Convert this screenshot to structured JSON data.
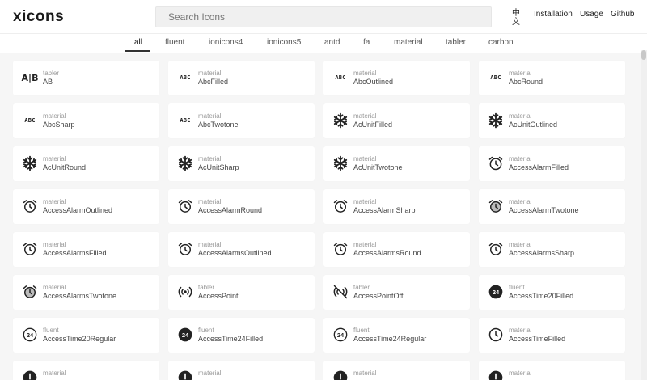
{
  "header": {
    "logo": "xicons",
    "search_placeholder": "Search Icons",
    "lang_label": "中文",
    "nav": [
      "Installation",
      "Usage",
      "Github"
    ]
  },
  "tabs": [
    "all",
    "fluent",
    "ionicons4",
    "ionicons5",
    "antd",
    "fa",
    "material",
    "tabler",
    "carbon"
  ],
  "active_tab": "all",
  "icons": [
    {
      "source": "tabler",
      "name": "AB",
      "icon": "ab-icon"
    },
    {
      "source": "material",
      "name": "AbcFilled",
      "icon": "abc-icon"
    },
    {
      "source": "material",
      "name": "AbcOutlined",
      "icon": "abc-icon"
    },
    {
      "source": "material",
      "name": "AbcRound",
      "icon": "abc-icon"
    },
    {
      "source": "material",
      "name": "AbcSharp",
      "icon": "abc-icon"
    },
    {
      "source": "material",
      "name": "AbcTwotone",
      "icon": "abc-icon"
    },
    {
      "source": "material",
      "name": "AcUnitFilled",
      "icon": "snowflake-icon"
    },
    {
      "source": "material",
      "name": "AcUnitOutlined",
      "icon": "snowflake-icon"
    },
    {
      "source": "material",
      "name": "AcUnitRound",
      "icon": "snowflake-icon"
    },
    {
      "source": "material",
      "name": "AcUnitSharp",
      "icon": "snowflake-icon"
    },
    {
      "source": "material",
      "name": "AcUnitTwotone",
      "icon": "snowflake-icon"
    },
    {
      "source": "material",
      "name": "AccessAlarmFilled",
      "icon": "alarm-icon"
    },
    {
      "source": "material",
      "name": "AccessAlarmOutlined",
      "icon": "alarm-clock-icon"
    },
    {
      "source": "material",
      "name": "AccessAlarmRound",
      "icon": "alarm-clock-icon"
    },
    {
      "source": "material",
      "name": "AccessAlarmSharp",
      "icon": "alarm-clock-icon"
    },
    {
      "source": "material",
      "name": "AccessAlarmTwotone",
      "icon": "alarm-clock-twotone-icon"
    },
    {
      "source": "material",
      "name": "AccessAlarmsFilled",
      "icon": "alarm-clock-icon"
    },
    {
      "source": "material",
      "name": "AccessAlarmsOutlined",
      "icon": "alarm-clock-icon"
    },
    {
      "source": "material",
      "name": "AccessAlarmsRound",
      "icon": "alarm-clock-icon"
    },
    {
      "source": "material",
      "name": "AccessAlarmsSharp",
      "icon": "alarm-clock-icon"
    },
    {
      "source": "material",
      "name": "AccessAlarmsTwotone",
      "icon": "alarm-clock-twotone-icon"
    },
    {
      "source": "tabler",
      "name": "AccessPoint",
      "icon": "access-point-icon"
    },
    {
      "source": "tabler",
      "name": "AccessPointOff",
      "icon": "access-point-off-icon"
    },
    {
      "source": "fluent",
      "name": "AccessTime20Filled",
      "icon": "time-24-filled-icon"
    },
    {
      "source": "fluent",
      "name": "AccessTime20Regular",
      "icon": "time-24-regular-icon"
    },
    {
      "source": "fluent",
      "name": "AccessTime24Filled",
      "icon": "time-24-filled-icon"
    },
    {
      "source": "fluent",
      "name": "AccessTime24Regular",
      "icon": "time-24-regular-icon"
    },
    {
      "source": "material",
      "name": "AccessTimeFilled",
      "icon": "clock-icon"
    },
    {
      "source": "material",
      "name": "",
      "icon": "clock-filled-icon"
    },
    {
      "source": "material",
      "name": "",
      "icon": "clock-filled-icon"
    },
    {
      "source": "material",
      "name": "",
      "icon": "clock-filled-icon"
    },
    {
      "source": "material",
      "name": "",
      "icon": "clock-filled-icon"
    }
  ]
}
